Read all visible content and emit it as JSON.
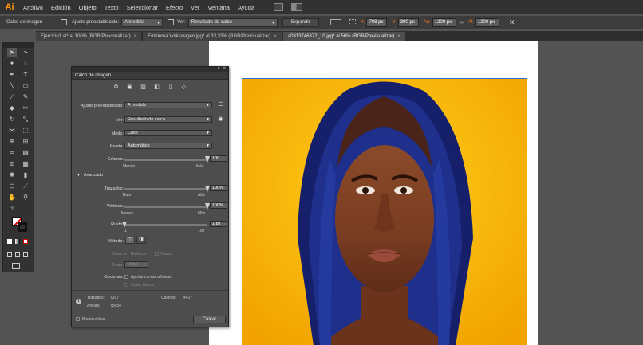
{
  "app": {
    "logo": "Ai"
  },
  "menu": [
    "Archivo",
    "Edición",
    "Objeto",
    "Texto",
    "Seleccionar",
    "Efecto",
    "Ver",
    "Ventana",
    "Ayuda"
  ],
  "options_bar": {
    "panel_label": "Calco de imagen",
    "preset_label": "Ajuste preestablecido:",
    "preset_value": "A medida",
    "view_label": "Ver:",
    "view_value": "Resultado de calco",
    "expand_button": "Expandir",
    "x_label": "X:",
    "x_value": "708 px",
    "y_label": "Y:",
    "y_value": "390 px",
    "w_label": "An:",
    "w_value": "1200 px",
    "h_label": "Al:",
    "h_value": "1200 px"
  },
  "tabs": [
    {
      "label": "Ejercicio1.ai* al 100% (RGB/Previsualizar)",
      "close": "×"
    },
    {
      "label": "Emblema Volkswagen.jpg* al 33,33% (RGB/Previsualizar)",
      "close": "×"
    },
    {
      "label": "a0813746872_10.jpg* al 50% (RGB/Previsualizar)",
      "close": "×",
      "active": true
    }
  ],
  "dialog": {
    "title": "Calco de imagen",
    "preset_label": "Ajuste preestablecido:",
    "preset_value": "A medida",
    "view_label": "Ver:",
    "view_value": "Resultado de calco",
    "mode_label": "Modo:",
    "mode_value": "Color",
    "palette_label": "Paleta:",
    "palette_value": "Automático",
    "colors_label": "Colores:",
    "colors_value": "100",
    "colors_level": 1.0,
    "colors_min": "Menos",
    "colors_max": "Más",
    "advanced_label": "Avanzado",
    "paths_label": "Trazados:",
    "paths_value": "100%",
    "paths_level": 1.0,
    "paths_min": "Baja",
    "paths_max": "Alta",
    "corners_label": "Vértices:",
    "corners_value": "100%",
    "corners_level": 1.0,
    "corners_min": "Menos",
    "corners_max": "Más",
    "noise_label": "Ruido:",
    "noise_value": "1 px",
    "noise_level": 0.0,
    "noise_min": "1",
    "noise_max": "100",
    "method_label": "Método:",
    "create_label": "Crear:",
    "fills_label": "Rellenos",
    "strokes_label": "Trazos",
    "stroke_label": "Trazo:",
    "stroke_value": "10 px",
    "options_label": "Opciones:",
    "snap_label": "Ajustar curvas a líneas",
    "ignore_white_label": "Omitir blanco",
    "info_paths_label": "Trazados:",
    "info_paths_value": "7297",
    "info_colors_label": "Colores:",
    "info_colors_value": "4427",
    "info_anchors_label": "Anclas:",
    "info_anchors_value": "75654",
    "preview_label": "Previsualizar",
    "trace_button": "Calcar"
  },
  "colors": {
    "accent": "#ff9a00",
    "photo_bg": "#f6b400",
    "hair": "#1a2a7a"
  }
}
